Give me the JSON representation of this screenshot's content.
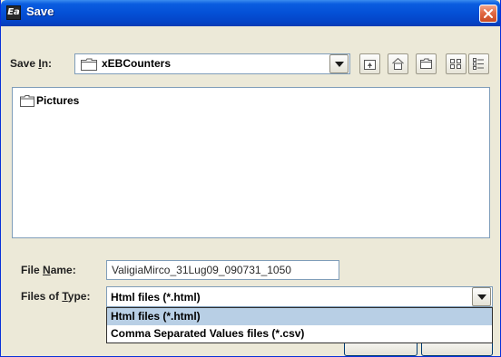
{
  "window": {
    "title": "Save",
    "icon": "app-logo-icon",
    "icon_glyph": "Ea"
  },
  "save_in": {
    "label_prefix": "Save ",
    "label_mnemonic": "I",
    "label_suffix": "n:",
    "value": "xEBCounters",
    "folder_icon": "folder-icon"
  },
  "toolbar": {
    "up_icon": "up-one-level-icon",
    "home_icon": "home-icon",
    "new_folder_icon": "new-folder-icon",
    "list_icon": "list-view-icon",
    "details_icon": "details-view-icon"
  },
  "file_list": {
    "items": [
      {
        "name": "Pictures",
        "icon": "folder-icon"
      }
    ]
  },
  "file_name": {
    "label_prefix": "File ",
    "label_mnemonic": "N",
    "label_suffix": "ame:",
    "value": "ValigiaMirco_31Lug09_090731_1050"
  },
  "file_type": {
    "label_prefix": "Files of ",
    "label_mnemonic": "T",
    "label_suffix": "ype:",
    "selected": "Html files (*.html)",
    "options": [
      "Html files (*.html)",
      "Comma Separated Values files (*.csv)"
    ]
  }
}
